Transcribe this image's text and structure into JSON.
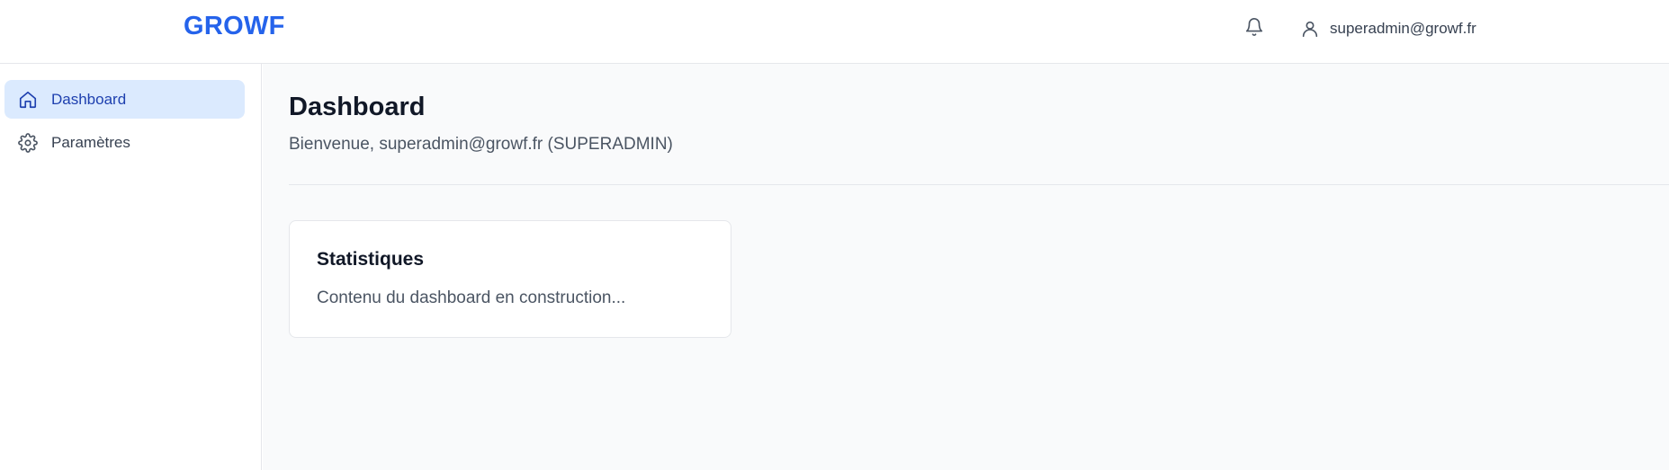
{
  "header": {
    "brand": "GROWF",
    "user_email": "superadmin@growf.fr",
    "icons": {
      "notifications": "bell-icon",
      "user": "user-icon"
    }
  },
  "sidebar": {
    "items": [
      {
        "label": "Dashboard",
        "icon": "home-icon",
        "active": true
      },
      {
        "label": "Paramètres",
        "icon": "gear-icon",
        "active": false
      }
    ]
  },
  "main": {
    "title": "Dashboard",
    "welcome": "Bienvenue, superadmin@growf.fr (SUPERADMIN)",
    "card": {
      "title": "Statistiques",
      "text": "Contenu du dashboard en construction..."
    }
  },
  "colors": {
    "brand": "#2563eb",
    "active_bg": "#dbeafe",
    "active_text": "#1e40af",
    "page_bg": "#f9fafb"
  }
}
